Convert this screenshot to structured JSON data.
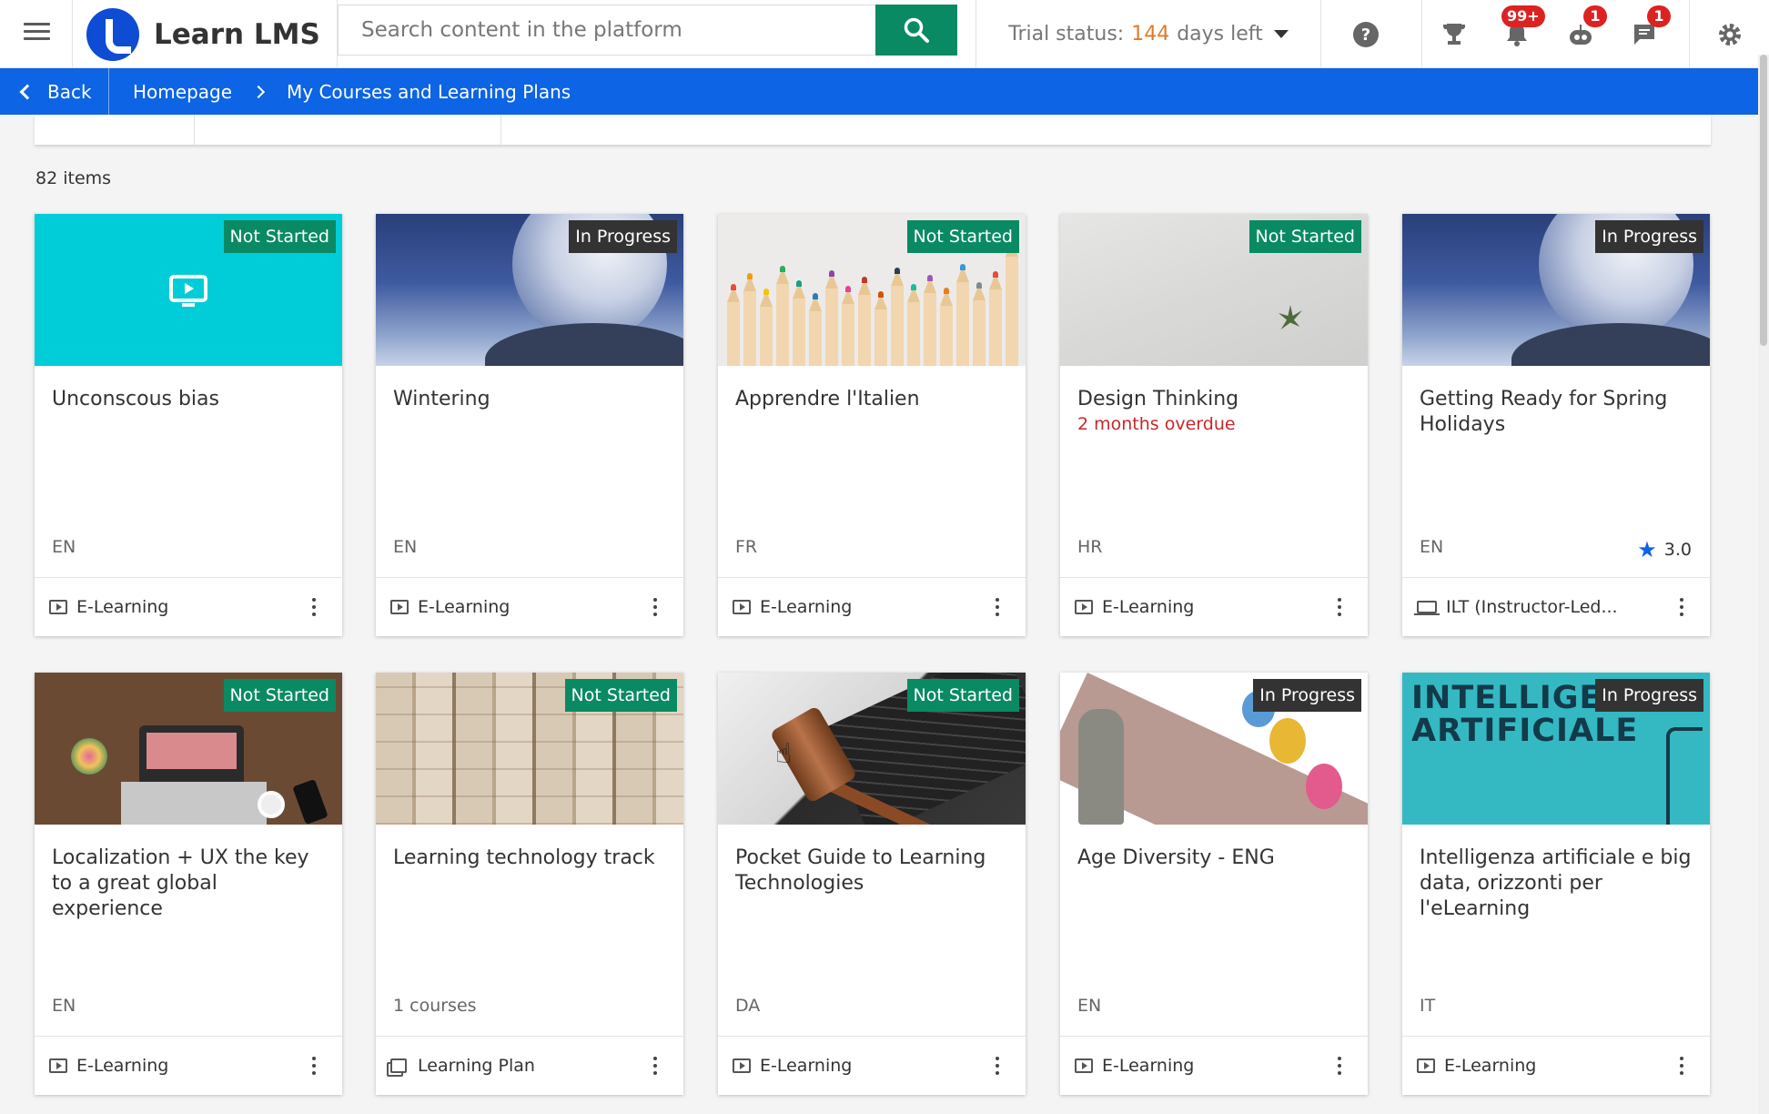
{
  "app": {
    "name": "Learn LMS"
  },
  "search": {
    "placeholder": "Search content in the platform"
  },
  "trial": {
    "prefix": "Trial status:",
    "days": "144",
    "suffix": "days left"
  },
  "notifications": {
    "bell_badge": "99+",
    "bot_badge": "1",
    "chat_badge": "1"
  },
  "breadcrumb": {
    "back": "Back",
    "home": "Homepage",
    "current": "My Courses and Learning Plans"
  },
  "results": {
    "count": "82 items"
  },
  "colors": {
    "primary_blue": "#0d64e4",
    "accent_green": "#0a8a63",
    "overdue_red": "#c62828",
    "trial_orange": "#e07b2a"
  },
  "cards": [
    {
      "title": "Unconscous bias",
      "status": "Not Started",
      "lang": "EN",
      "type": "E-Learning",
      "thumb": "video-placeholder"
    },
    {
      "title": "Wintering",
      "status": "In Progress",
      "lang": "EN",
      "type": "E-Learning",
      "thumb": "frozen-bubble"
    },
    {
      "title": "Apprendre l'Italien",
      "status": "Not Started",
      "lang": "FR",
      "type": "E-Learning",
      "thumb": "colored-pencils"
    },
    {
      "title": "Design Thinking",
      "status": "Not Started",
      "overdue": "2 months overdue",
      "lang": "HR",
      "type": "E-Learning",
      "thumb": "plant-in-sand"
    },
    {
      "title": "Getting Ready for Spring Holidays",
      "status": "In Progress",
      "lang": "EN",
      "rating": "3.0",
      "type": "ILT (Instructor-Led...",
      "thumb": "frozen-bubble"
    },
    {
      "title": "Localization + UX the key to a great global experience",
      "status": "Not Started",
      "lang": "EN",
      "type": "E-Learning",
      "thumb": "laptop-desk"
    },
    {
      "title": "Learning technology track",
      "status": "Not Started",
      "lang": "1 courses",
      "type": "Learning Plan",
      "thumb": "open-books"
    },
    {
      "title": "Pocket Guide to Learning Technologies",
      "status": "Not Started",
      "lang": "DA",
      "type": "E-Learning",
      "thumb": "gavel-keyboard"
    },
    {
      "title": "Age Diversity - ENG",
      "status": "In Progress",
      "lang": "EN",
      "type": "E-Learning",
      "thumb": "cartoon-meeting"
    },
    {
      "title": "Intelligenza artificiale e big data, orizzonti per l'eLearning",
      "status": "In Progress",
      "lang": "IT",
      "type": "E-Learning",
      "thumb": "ai-banner",
      "thumb_text": "INTELLIGEN\nARTIFICIALE"
    }
  ]
}
